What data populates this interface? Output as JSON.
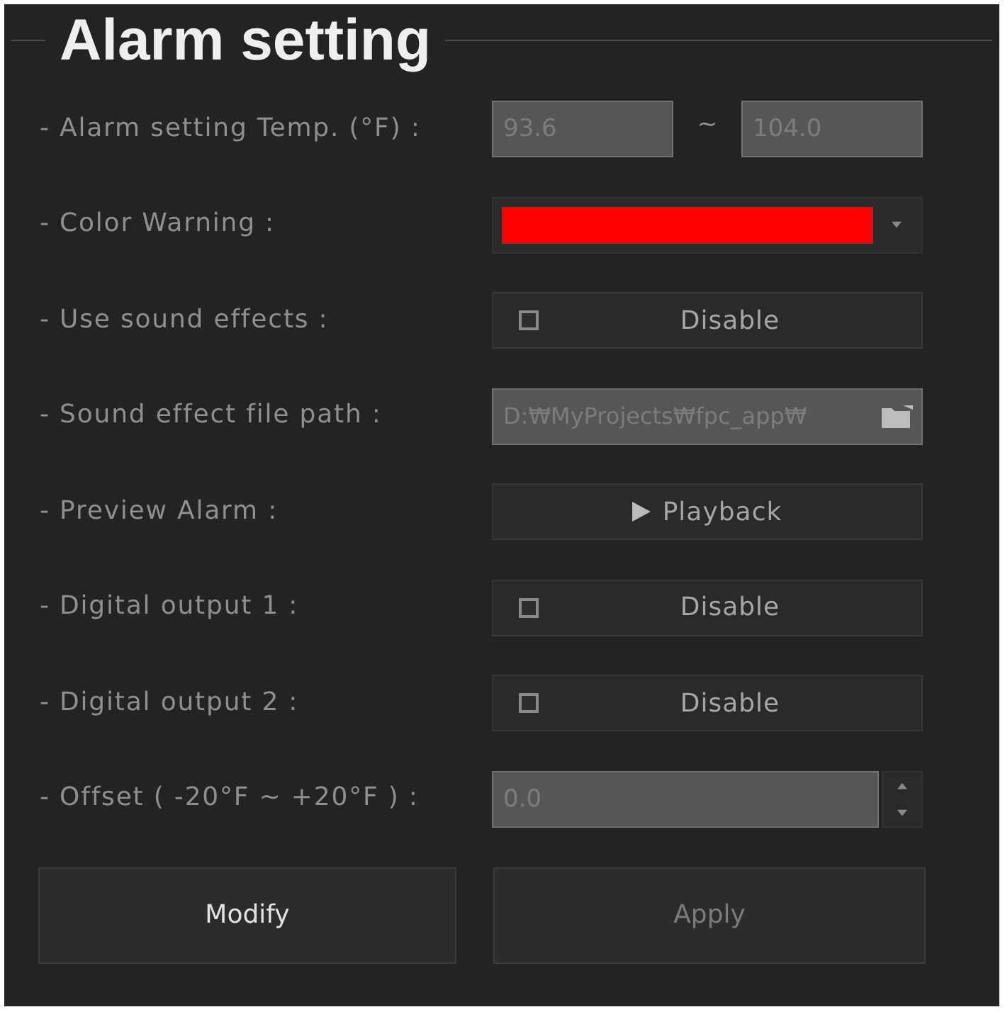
{
  "panel": {
    "title": "Alarm setting"
  },
  "rows": [
    {
      "kind": "range",
      "label": "- Alarm setting Temp. (°F) :",
      "low": {
        "value": "93.6",
        "disabled": true
      },
      "separator": "~",
      "high": {
        "value": "104.0",
        "disabled": true
      }
    },
    {
      "kind": "color",
      "label": "- Color Warning :",
      "color": "#ff0000"
    },
    {
      "kind": "toggle",
      "label": "- Use sound effects :",
      "text": "Disable",
      "checked": false
    },
    {
      "kind": "file",
      "label": "- Sound effect file path :",
      "value": "D:₩MyProjects₩fpc_app₩",
      "disabled": true
    },
    {
      "kind": "action",
      "label": "- Preview Alarm :",
      "text": "Playback"
    },
    {
      "kind": "toggle",
      "label": "- Digital output 1 :",
      "text": "Disable",
      "checked": false
    },
    {
      "kind": "toggle",
      "label": "- Digital output 2 :",
      "text": "Disable",
      "checked": false
    },
    {
      "kind": "spin",
      "label": "- Offset ( -20°F ~ +20°F ) :",
      "value": "0.0",
      "disabled": true
    }
  ],
  "buttons": [
    {
      "label": "Modify",
      "disabled": false
    },
    {
      "label": "Apply",
      "disabled": true
    }
  ]
}
